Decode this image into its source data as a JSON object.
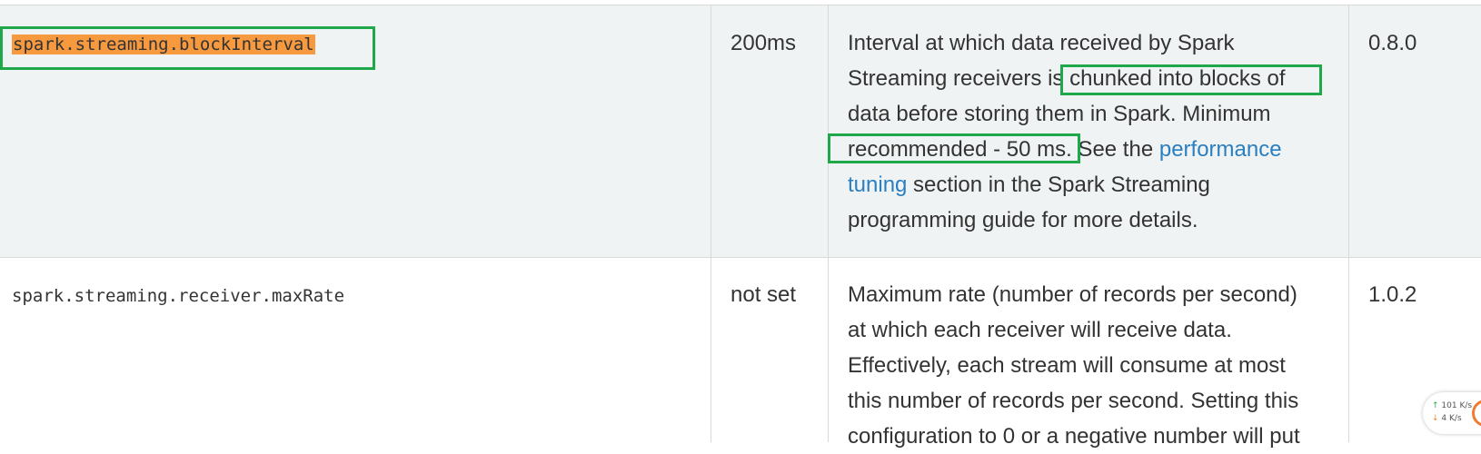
{
  "rows": [
    {
      "property": "spark.streaming.blockInterval",
      "default": "200ms",
      "meaning_lines": [
        "Interval at which data received by Spark",
        "Streaming receivers is ",
        "chunked into blocks of",
        "data before storing them in Spark. Minimum",
        "recommended - 50 ms.",
        " See the ",
        "performance",
        "tuning",
        " section in the Spark Streaming",
        "programming guide for more details."
      ],
      "since": "0.8.0"
    },
    {
      "property": "spark.streaming.receiver.maxRate",
      "default": "not set",
      "meaning_lines": [
        "Maximum rate (number of records per second)",
        "at which each receiver will receive data.",
        "Effectively, each stream will consume at most",
        "this number of records per second. Setting this",
        "configuration to 0 or a negative number will put"
      ],
      "since": "1.0.2"
    }
  ],
  "net_widget": {
    "upload": "101 K/s",
    "download": "4  K/s",
    "up_arrow": "↑",
    "down_arrow": "↓"
  },
  "colors": {
    "highlight": "#f6993f",
    "annotation_box": "#1ea84a",
    "link": "#2a7fc1",
    "row_shade": "#f0f3f4"
  }
}
